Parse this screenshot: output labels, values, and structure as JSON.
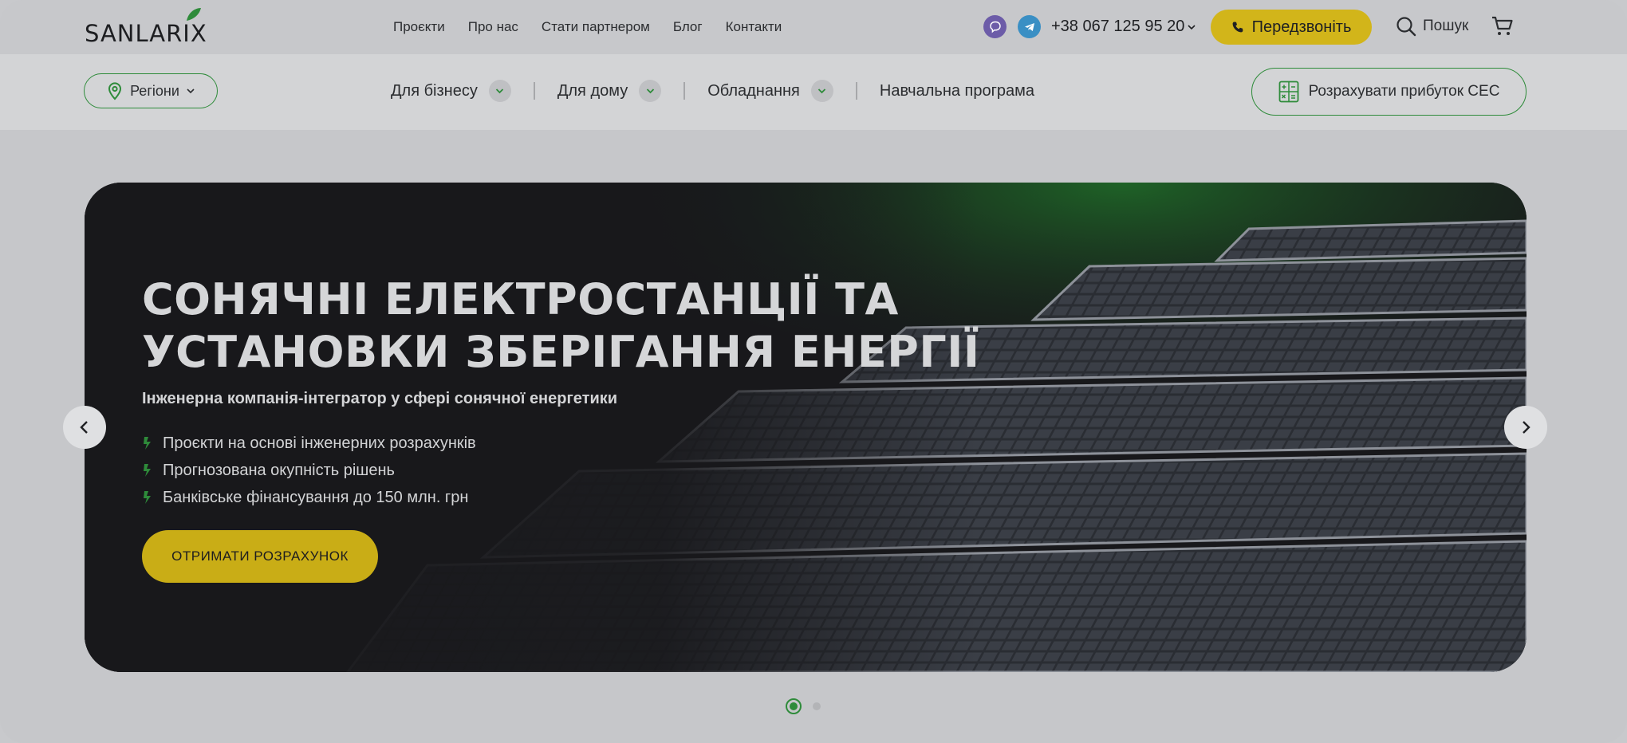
{
  "brand": {
    "logo_text": "SANLARIX"
  },
  "topnav": {
    "items": [
      {
        "label": "Проєкти"
      },
      {
        "label": "Про нас"
      },
      {
        "label": "Стати партнером"
      },
      {
        "label": "Блог"
      },
      {
        "label": "Контакти"
      }
    ]
  },
  "contacts": {
    "phone": "+38 067 125 95 20",
    "callback_label": "Передзвоніть",
    "search_label": "Пошук",
    "icons": [
      "viber-icon",
      "telegram-icon",
      "phone-icon",
      "search-icon",
      "cart-icon"
    ]
  },
  "subnav": {
    "regions_label": "Регіони",
    "categories": [
      {
        "label": "Для бізнесу",
        "has_dropdown": true
      },
      {
        "label": "Для дому",
        "has_dropdown": true
      },
      {
        "label": "Обладнання",
        "has_dropdown": true
      },
      {
        "label": "Навчальна програма",
        "has_dropdown": false
      }
    ],
    "calc_label": "Розрахувати прибуток СЕС"
  },
  "hero": {
    "title_line1": "СОНЯЧНІ ЕЛЕКТРОСТАНЦІЇ ТА",
    "title_line2": "УСТАНОВКИ ЗБЕРІГАННЯ ЕНЕРГІЇ",
    "subtitle": "Інженерна компанія-інтегратор у сфері сонячної енергетики",
    "bullets": [
      "Проєкти на основі інженерних розрахунків",
      "Прогнозована окупність рішень",
      "Банківське фінансування до 150 млн. грн"
    ],
    "cta_label": "ОТРИМАТИ РОЗРАХУНОК"
  },
  "slider": {
    "total_slides": 2,
    "active_slide": 1
  },
  "colors": {
    "accent_green": "#2e8b3a",
    "accent_yellow": "#d2b51a",
    "hero_bg": "#18181b"
  }
}
